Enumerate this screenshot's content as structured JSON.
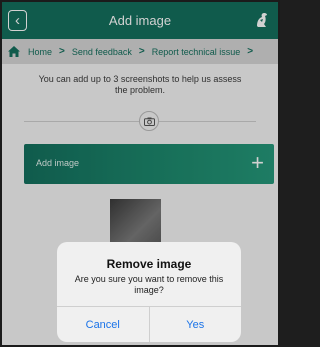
{
  "header": {
    "title": "Add image",
    "back_icon": "chevron-left-icon",
    "logo_icon": "liver-bird-logo-icon"
  },
  "breadcrumb": {
    "home_icon": "home-icon",
    "items": [
      "Home",
      "Send feedback",
      "Report technical issue"
    ],
    "separator": ">"
  },
  "content": {
    "intro": "You can add up to 3 screenshots to help us assess the problem.",
    "camera_icon": "camera-icon",
    "add_image_label": "Add image",
    "add_icon": "plus-icon"
  },
  "alert": {
    "title": "Remove image",
    "message": "Are you sure you want to remove this image?",
    "cancel_label": "Cancel",
    "confirm_label": "Yes"
  },
  "colors": {
    "brand": "#146f5d",
    "action_blue": "#1a73e8"
  }
}
